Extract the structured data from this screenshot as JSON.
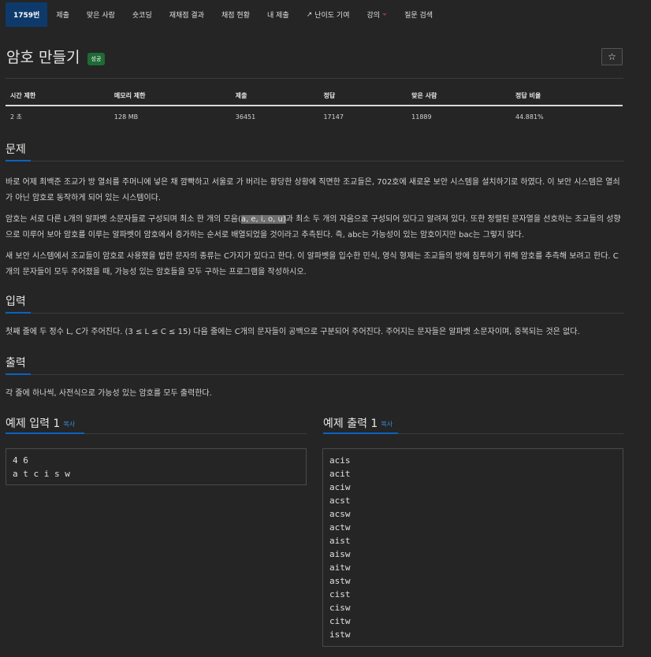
{
  "nav": {
    "items": [
      "1759번",
      "제출",
      "맞은 사람",
      "숏코딩",
      "재채점 결과",
      "채점 현황",
      "내 제출",
      "난이도 기여",
      "강의",
      "질문 검색"
    ]
  },
  "problem": {
    "title": "암호 만들기",
    "badge": "성공",
    "star": "☆"
  },
  "stats": {
    "headers": [
      "시간 제한",
      "메모리 제한",
      "제출",
      "정답",
      "맞은 사람",
      "정답 비율"
    ],
    "values": [
      "2 초",
      "128 MB",
      "36451",
      "17147",
      "11889",
      "44.881%"
    ]
  },
  "sections": {
    "desc_title": "문제",
    "desc_p1": "바로 어제 최백준 조교가 방 열쇠를 주머니에 넣은 채 깜빡하고 서울로 가 버리는 황당한 상황에 직면한 조교들은, 702호에 새로운 보안 시스템을 설치하기로 하였다. 이 보안 시스템은 열쇠가 아닌 암호로 동작하게 되어 있는 시스템이다.",
    "desc_p2_a": "암호는 서로 다른 L개의 알파벳 소문자들로 구성되며 최소 한 개의 모음(",
    "desc_p2_hl": "a, e, i, o, u)",
    "desc_p2_b": "과 최소 두 개의 자음으로 구성되어 있다고 알려져 있다. 또한 정렬된 문자열을 선호하는 조교들의 성향으로 미루어 보아 암호를 이루는 알파벳이 암호에서 증가하는 순서로 배열되었을 것이라고 추측된다. 즉, abc는 가능성이 있는 암호이지만 bac는 그렇지 않다.",
    "desc_p3": "새 보안 시스템에서 조교들이 암호로 사용했을 법한 문자의 종류는 C가지가 있다고 한다. 이 알파벳을 입수한 민식, 영식 형제는 조교들의 방에 침투하기 위해 암호를 추측해 보려고 한다. C개의 문자들이 모두 주어졌을 때, 가능성 있는 암호들을 모두 구하는 프로그램을 작성하시오.",
    "input_title": "입력",
    "input_p": "첫째 줄에 두 정수 L, C가 주어진다. (3 ≤ L ≤ C ≤ 15) 다음 줄에는 C개의 문자들이 공백으로 구분되어 주어진다. 주어지는 문자들은 알파벳 소문자이며, 중복되는 것은 없다.",
    "output_title": "출력",
    "output_p": "각 줄에 하나씩, 사전식으로 가능성 있는 암호를 모두 출력한다."
  },
  "examples": {
    "input_title": "예제 입력 1",
    "output_title": "예제 출력 1",
    "copy": "복사",
    "input_text": "4 6\na t c i s w",
    "output_text": "acis\nacit\naciw\nacst\nacsw\nactw\naist\naisw\naitw\nastw\ncist\ncisw\ncitw\nistw"
  }
}
